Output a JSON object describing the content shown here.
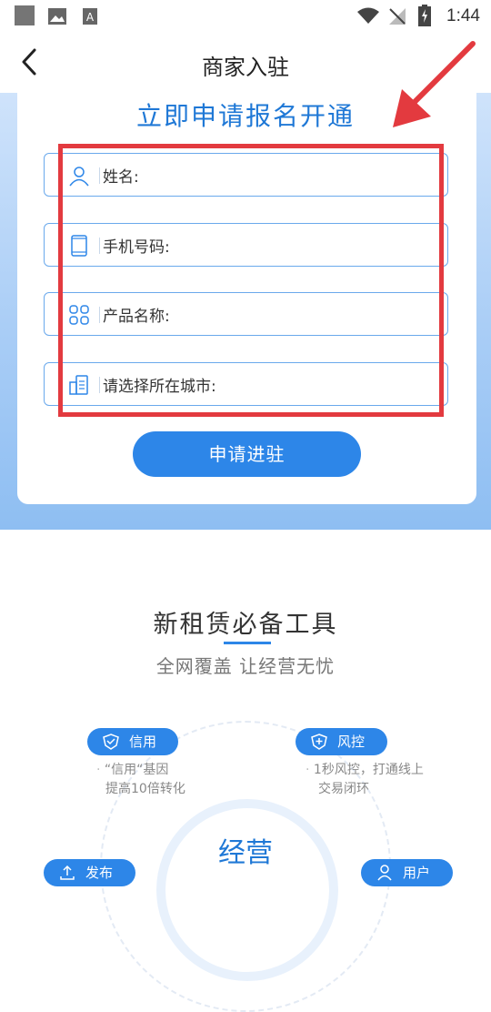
{
  "status_bar": {
    "time": "1:44"
  },
  "nav": {
    "title": "商家入驻"
  },
  "form": {
    "title": "立即申请报名开通",
    "fields": [
      {
        "label": "姓名:",
        "icon": "person-icon"
      },
      {
        "label": "手机号码:",
        "icon": "phone-icon"
      },
      {
        "label": "产品名称:",
        "icon": "grid-icon"
      },
      {
        "label": "请选择所在城市:",
        "icon": "building-icon"
      }
    ],
    "submit_label": "申请进驻"
  },
  "section": {
    "title": "新租赁必备工具",
    "subtitle": "全网覆盖 让经营无忧",
    "core_label": "经营",
    "features": [
      {
        "label": "信用",
        "icon": "shield-icon",
        "desc_line1": "“信用“基因",
        "desc_line2": "提高10倍转化"
      },
      {
        "label": "风控",
        "icon": "shield-plus-icon",
        "desc_line1": "1秒风控，打通线上",
        "desc_line2": "交易闭环"
      },
      {
        "label": "发布",
        "icon": "upload-icon"
      },
      {
        "label": "用户",
        "icon": "user-icon"
      }
    ]
  },
  "colors": {
    "accent": "#2d86e8",
    "title_blue": "#1f78d6",
    "annotation_red": "#e33a3f"
  }
}
